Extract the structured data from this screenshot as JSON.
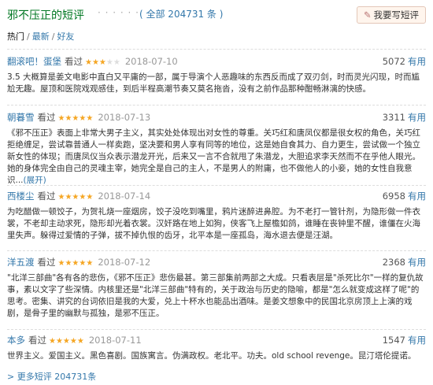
{
  "header": {
    "title": "邪不压正的短评",
    "dots": "· · · · · ·",
    "total": "( 全部 204731 条 )",
    "write_button": "我要写短评"
  },
  "tabs": [
    {
      "label": "热门",
      "active": true
    },
    {
      "label": "最新",
      "active": false
    },
    {
      "label": "好友",
      "active": false
    }
  ],
  "tab_sep": "/",
  "reviews": [
    {
      "user": "翻滚吧！蛋堡",
      "status": "看过",
      "rating": 3,
      "date": "2018-07-10",
      "votes": "5072",
      "useful": "有用",
      "content": "3.5 大概算是姜文电影中直白又平庸的一部，属于导演个人恶趣味的东西反而成了双刃剑，时而灵光闪现，时而尴尬无趣。屋顶和医院戏观感佳，到后半程高潮节奏又莫名拖沓，没有之前作品那种酣畅淋漓的快感。",
      "expand": ""
    },
    {
      "user": "朝暮雪",
      "status": "看过",
      "rating": 5,
      "date": "2018-07-13",
      "votes": "3311",
      "useful": "有用",
      "content": "《邪不压正》表面上非常大男子主义，其实处处体现出对女性的尊重。关巧红和唐凤仪都是很女权的角色，关巧红拒绝缠足，尝试靠普通人一样卖跑，坚决要和男人享有同等的地位，这是她自食其力、自力更生，尝试做一个独立新女性的体现；而唐凤仪当众表示潜龙开光，后来又一言不合就甩了朱潜龙，大胆追求李天然而不在乎他人眼光。她的身体完全由自己的灵魂主宰，她完全是自己的主人，不是男人的附庸，也不做他人的小妾，她的女性自我意识...",
      "expand": "(展开)"
    },
    {
      "user": "西楼尘",
      "status": "看过",
      "rating": 5,
      "date": "2018-07-14",
      "votes": "6958",
      "useful": "有用",
      "content": "为吃醋做一顿饺子，为贺礼烧一座烟房，饺子没吃到嘴里，鸦片迷醉进鼻腔。为不老打一管针剂，为隐形做一件衣裳，不老却主动求死，隐形却光着衣裳。汉奸路在地上如狗，侠客飞上屋檐如鸽，谁睡在丧钟里不醒，谁僵在火海里失声。躲得过爱情的子弹，拔不掉仇恨的齿牙，北平本是一座孤岛，海水退去便是汪湖。",
      "expand": ""
    },
    {
      "user": "洋五渡",
      "status": "看过",
      "rating": 5,
      "date": "2018-07-12",
      "votes": "2368",
      "useful": "有用",
      "content": "\"北洋三部曲\"各有各的悲伤，《邪不压正》悲伤最甚。第三部集前两部之大成。只看表层是\"杀死比尔\"一样的复仇故事，素以文字了些深情。内核里还是\"北洋三部曲\"特有的，关于政治与历史的隐喻，都是\"怎么就变成这样了呢\"的思考。密集、讲究的台词依旧是我的大爱，兑上十杯水也能品出酒味。是姜文想象中的民国北京房顶上上演的戏剧，是骨子里的幽默与孤独，是邪不压正。",
      "expand": ""
    },
    {
      "user": "本多",
      "status": "看过",
      "rating": 5,
      "date": "2018-07-11",
      "votes": "1547",
      "useful": "有用",
      "content": "世界主义。爱国主义。黑色喜剧。国族寓言。伪满政权。老北平。功夫。old school revenge。昆汀塔伦提诺。",
      "expand": ""
    }
  ],
  "more_link": "> 更多短评 204731条"
}
